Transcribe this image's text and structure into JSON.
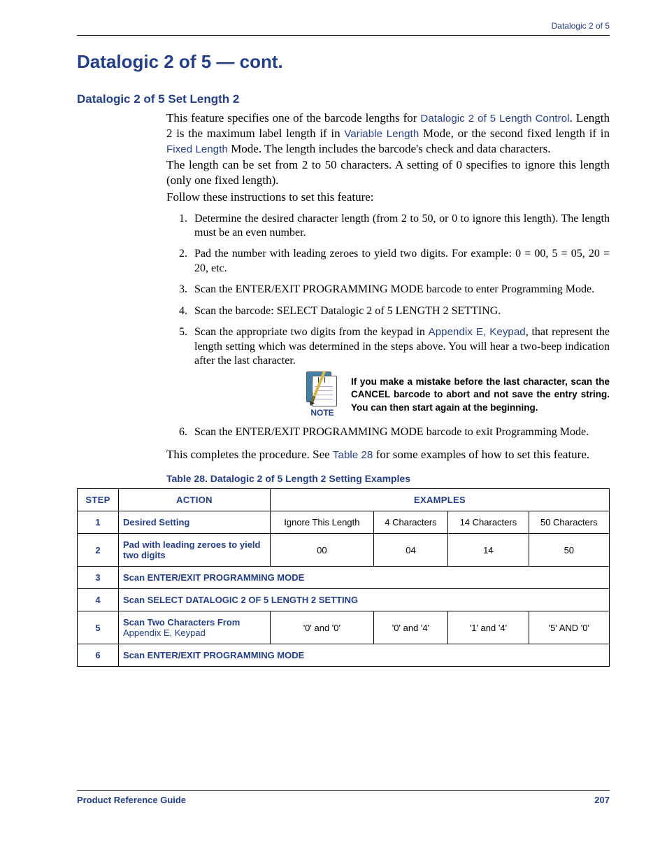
{
  "running_head": "Datalogic 2 of 5",
  "section_title": "Datalogic 2 of 5 — cont.",
  "subsection_title": "Datalogic 2 of 5 Set Length 2",
  "intro": {
    "p1a": "This feature specifies one of the barcode lengths for ",
    "link1": "Datalogic 2 of 5 Length Control",
    "p1b": ". Length 2 is the maximum label length if in ",
    "link2": "Variable Length",
    "p1c": " Mode, or the second fixed length if in ",
    "link3": "Fixed Length",
    "p1d": " Mode. The length includes the barcode's check and data characters.",
    "p2": "The length can be set from 2 to 50 characters. A setting of 0 specifies to ignore this length (only one fixed length).",
    "p3": "Follow these instructions to set this feature:"
  },
  "steps": {
    "s1": "Determine the desired character length (from 2 to 50, or 0 to ignore this length). The length must be an even number.",
    "s2": "Pad the number with leading zeroes to yield two digits. For example: 0 = 00, 5 = 05, 20 = 20, etc.",
    "s3": "Scan the ENTER/EXIT PROGRAMMING MODE barcode to enter Programming Mode.",
    "s4": "Scan the barcode: SELECT Datalogic 2 of 5 LENGTH 2 SETTING.",
    "s5a": "Scan the appropriate two digits from the keypad in ",
    "s5link": "Appendix E, Keypad",
    "s5b": ", that represent the length setting which was determined in the steps above. You will hear a two-beep indication after the last character.",
    "s6": "Scan the ENTER/EXIT PROGRAMMING MODE barcode to exit Programming Mode."
  },
  "note": {
    "label": "NOTE",
    "text": "If you make a mistake before the last character, scan the CANCEL barcode to abort and not save the entry string. You can then start again at the beginning."
  },
  "closing_a": "This completes the procedure. See ",
  "closing_link": "Table 28",
  "closing_b": " for some examples of how to set this feature.",
  "table": {
    "caption": "Table 28. Datalogic 2 of 5 Length 2 Setting Examples",
    "headers": {
      "step": "STEP",
      "action": "ACTION",
      "examples": "EXAMPLES"
    },
    "rows": [
      {
        "step": "1",
        "action": "Desired Setting",
        "ex": [
          "Ignore This Length",
          "4 Characters",
          "14 Characters",
          "50 Characters"
        ]
      },
      {
        "step": "2",
        "action": "Pad with leading zeroes to yield two digits",
        "ex": [
          "00",
          "04",
          "14",
          "50"
        ]
      },
      {
        "step": "3",
        "full": "Scan ENTER/EXIT PROGRAMMING MODE"
      },
      {
        "step": "4",
        "full": "Scan SELECT DATALOGIC 2 OF 5 LENGTH 2 SETTING"
      },
      {
        "step": "5",
        "action_a": "Scan Two Characters From ",
        "action_link": "Appendix E, Keypad",
        "ex": [
          "'0' and '0'",
          "'0' and '4'",
          "'1' and '4'",
          "'5' AND '0'"
        ]
      },
      {
        "step": "6",
        "full": "Scan ENTER/EXIT PROGRAMMING MODE"
      }
    ]
  },
  "footer": {
    "left": "Product Reference Guide",
    "right": "207"
  }
}
